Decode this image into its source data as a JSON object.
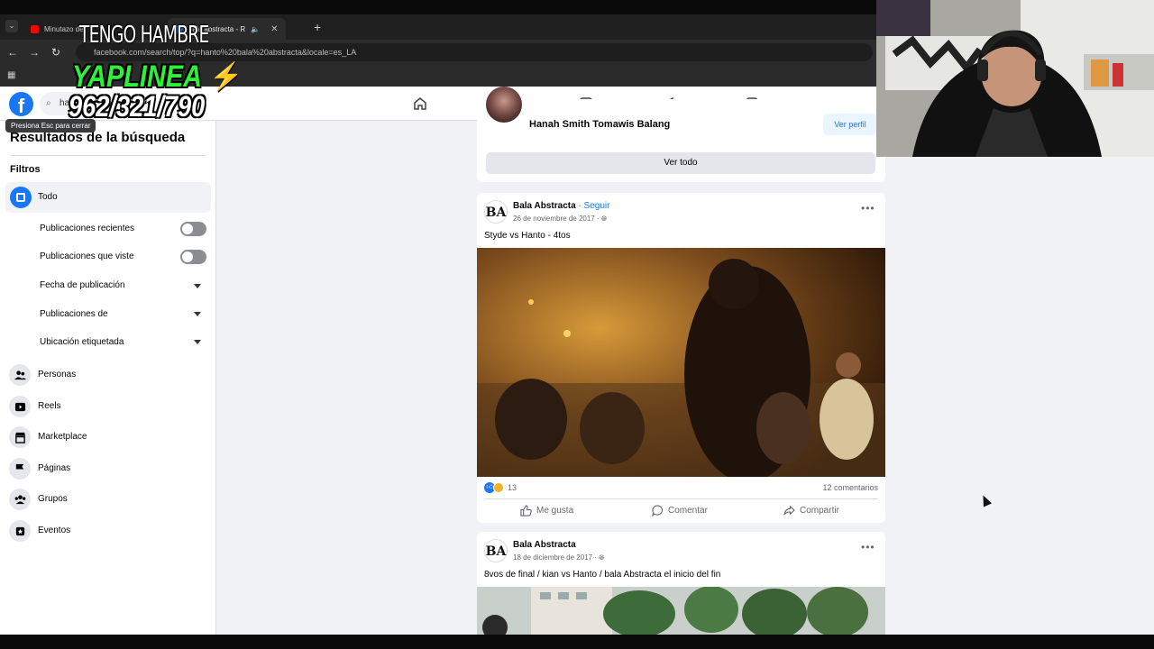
{
  "browser": {
    "tabs": [
      {
        "label": "Minutazo de",
        "active": false
      },
      {
        "label": "bala abstracta - R",
        "active": true
      }
    ],
    "url": "facebook.com/search/top/?q=hanto%20bala%20abstracta&locale=es_LA"
  },
  "fb": {
    "logo": "f",
    "search_value": "ha",
    "tooltip": "Presiona Esc para cerrar"
  },
  "sidebar": {
    "title": "Resultados de la búsqueda",
    "filters_label": "Filtros",
    "todo_label": "Todo",
    "toggles": [
      {
        "label": "Publicaciones recientes",
        "on": false
      },
      {
        "label": "Publicaciones que viste",
        "on": false
      }
    ],
    "dropdowns": [
      {
        "label": "Fecha de publicación"
      },
      {
        "label": "Publicaciones de"
      },
      {
        "label": "Ubicación etiquetada"
      }
    ],
    "categories": [
      {
        "label": "Personas",
        "icon": "people-icon"
      },
      {
        "label": "Reels",
        "icon": "reels-icon"
      },
      {
        "label": "Marketplace",
        "icon": "marketplace-icon"
      },
      {
        "label": "Páginas",
        "icon": "flag-icon"
      },
      {
        "label": "Grupos",
        "icon": "groups-icon"
      },
      {
        "label": "Eventos",
        "icon": "events-icon"
      }
    ]
  },
  "people_card": {
    "name": "Hanah Smith Tomawis Balang",
    "view_profile": "Ver perfil",
    "see_all": "Ver todo"
  },
  "post1": {
    "author": "Bala Abstracta",
    "follow": " · Seguir",
    "date": "26 de noviembre de 2017 · ",
    "text": "Styde vs Hanto - 4tos",
    "reaction_count": "13",
    "comments": "12 comentarios",
    "like": "Me gusta",
    "comment": "Comentar",
    "share": "Compartir"
  },
  "post2": {
    "author": "Bala Abstracta",
    "date": "18 de diciembre de 2017 · ",
    "text": "8vos de final / kian vs Hanto / bala Abstracta el inicio del fin"
  },
  "overlay": {
    "line1": "TENGO HAMBRE",
    "line2": "YAPLINEA",
    "line3": "962/321/790"
  },
  "colors": {
    "fb_blue": "#1877f2",
    "yape_green": "#2ff03a"
  }
}
